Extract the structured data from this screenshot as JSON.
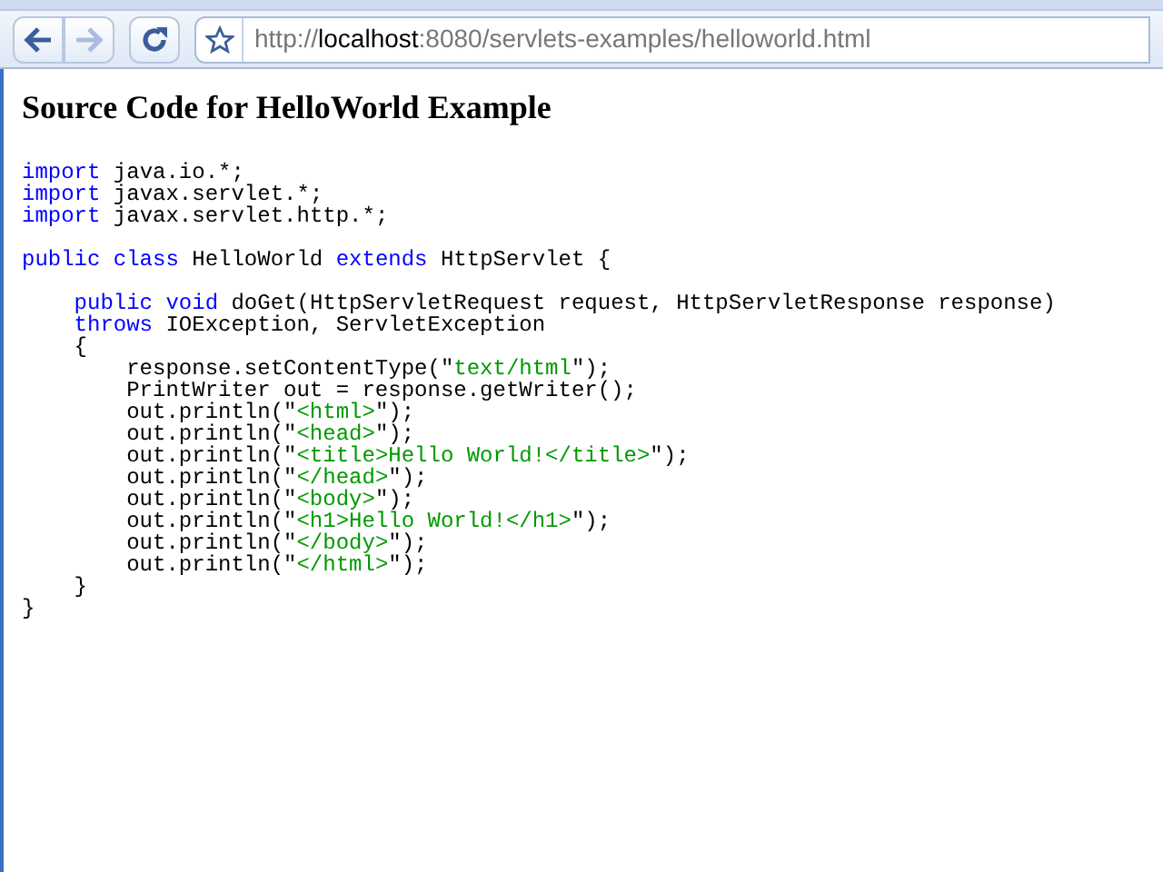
{
  "toolbar": {
    "buttons": [
      {
        "kind": "back",
        "disabled": false
      },
      {
        "kind": "forward",
        "disabled": true
      },
      {
        "kind": "reload",
        "disabled": false
      }
    ],
    "address": {
      "scheme": "http://",
      "host": "localhost",
      "rest": ":8080/servlets-examples/helloworld.html"
    }
  },
  "page": {
    "heading": "Source Code for HelloWorld Example",
    "code_blocks": [
      {
        "lines": [
          [
            {
              "kind": "kw",
              "text": "import"
            },
            {
              "kind": "plain",
              "text": " java.io.*;"
            }
          ],
          [
            {
              "kind": "kw",
              "text": "import"
            },
            {
              "kind": "plain",
              "text": " javax.servlet.*;"
            }
          ],
          [
            {
              "kind": "kw",
              "text": "import"
            },
            {
              "kind": "plain",
              "text": " javax.servlet.http.*;"
            }
          ]
        ]
      },
      {
        "lines": [
          [
            {
              "kind": "kw",
              "text": "public class"
            },
            {
              "kind": "plain",
              "text": " HelloWorld "
            },
            {
              "kind": "kw",
              "text": "extends"
            },
            {
              "kind": "plain",
              "text": " HttpServlet {"
            }
          ]
        ]
      },
      {
        "lines": [
          [
            {
              "kind": "kw",
              "text": "    public void"
            },
            {
              "kind": "plain",
              "text": " doGet(HttpServletRequest request, HttpServletResponse response)"
            }
          ],
          [
            {
              "kind": "kw",
              "text": "    throws"
            },
            {
              "kind": "plain",
              "text": " IOException, ServletException"
            }
          ],
          [
            {
              "kind": "plain",
              "text": "    {"
            }
          ],
          [
            {
              "kind": "plain",
              "text": "        response.setContentType(\""
            },
            {
              "kind": "str",
              "text": "text/html"
            },
            {
              "kind": "plain",
              "text": "\");"
            }
          ],
          [
            {
              "kind": "plain",
              "text": "        PrintWriter out = response.getWriter();"
            }
          ],
          [
            {
              "kind": "plain",
              "text": "        out.println(\""
            },
            {
              "kind": "str",
              "text": "<html>"
            },
            {
              "kind": "plain",
              "text": "\");"
            }
          ],
          [
            {
              "kind": "plain",
              "text": "        out.println(\""
            },
            {
              "kind": "str",
              "text": "<head>"
            },
            {
              "kind": "plain",
              "text": "\");"
            }
          ],
          [
            {
              "kind": "plain",
              "text": "        out.println(\""
            },
            {
              "kind": "str",
              "text": "<title>Hello World!</title>"
            },
            {
              "kind": "plain",
              "text": "\");"
            }
          ],
          [
            {
              "kind": "plain",
              "text": "        out.println(\""
            },
            {
              "kind": "str",
              "text": "</head>"
            },
            {
              "kind": "plain",
              "text": "\");"
            }
          ],
          [
            {
              "kind": "plain",
              "text": "        out.println(\""
            },
            {
              "kind": "str",
              "text": "<body>"
            },
            {
              "kind": "plain",
              "text": "\");"
            }
          ],
          [
            {
              "kind": "plain",
              "text": "        out.println(\""
            },
            {
              "kind": "str",
              "text": "<h1>Hello World!</h1>"
            },
            {
              "kind": "plain",
              "text": "\");"
            }
          ],
          [
            {
              "kind": "plain",
              "text": "        out.println(\""
            },
            {
              "kind": "str",
              "text": "</body>"
            },
            {
              "kind": "plain",
              "text": "\");"
            }
          ],
          [
            {
              "kind": "plain",
              "text": "        out.println(\""
            },
            {
              "kind": "str",
              "text": "</html>"
            },
            {
              "kind": "plain",
              "text": "\");"
            }
          ],
          [
            {
              "kind": "plain",
              "text": "    }"
            }
          ],
          [
            {
              "kind": "plain",
              "text": "}"
            }
          ]
        ]
      }
    ]
  }
}
